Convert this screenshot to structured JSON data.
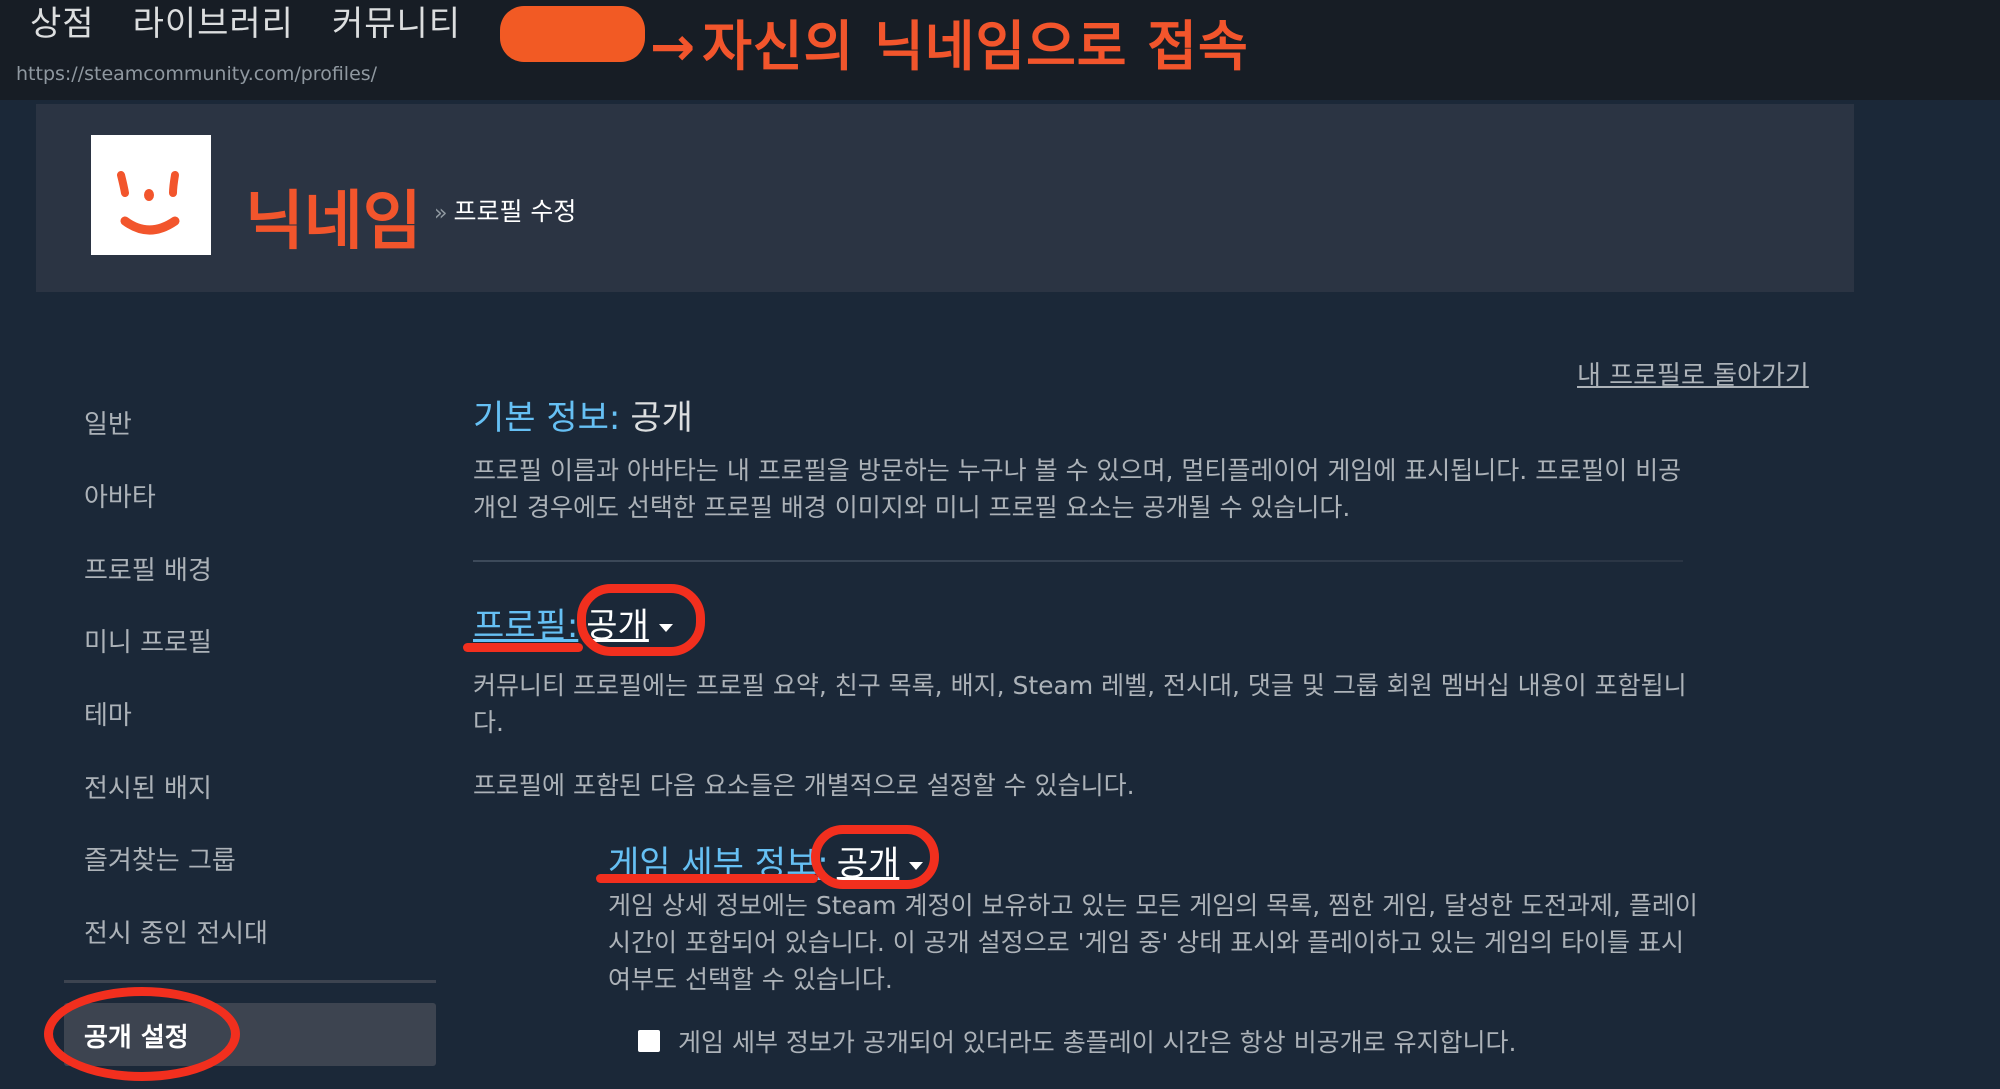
{
  "top_nav": {
    "items": [
      "상점",
      "라이브러리",
      "커뮤니티"
    ],
    "url": "https://steamcommunity.com/profiles/"
  },
  "annotation": {
    "top_arrow": "→",
    "top_note": "자신의 닉네임으로 접속",
    "nickname_note": "닉네임"
  },
  "profile_header": {
    "breadcrumb_sep": "»",
    "breadcrumb_page": "프로필 수정"
  },
  "sidebar": {
    "items": [
      "일반",
      "아바타",
      "프로필 배경",
      "미니 프로필",
      "테마",
      "전시된 배지",
      "즐겨찾는 그룹",
      "전시 중인 전시대"
    ],
    "active": "공개 설정"
  },
  "main": {
    "back_link": "내 프로필로 돌아가기",
    "basic": {
      "label": "기본 정보:",
      "value": "공개",
      "desc_line1": "프로필 이름과 아바타는 내 프로필을 방문하는 누구나 볼 수 있으며, 멀티플레이어 게임에 표시됩니다. 프로필이 비공",
      "desc_line2": "개인 경우에도 선택한 프로필 배경 이미지와 미니 프로필 요소는 공개될 수 있습니다."
    },
    "profile": {
      "label": "프로필:",
      "value": "공개",
      "desc_line1": "커뮤니티 프로필에는 프로필 요약, 친구 목록, 배지, Steam 레벨, 전시대, 댓글 및 그룹 회원 멤버십 내용이 포함됩니",
      "desc_line2": "다.",
      "sub_desc": "프로필에 포함된 다음 요소들은 개별적으로 설정할 수 있습니다."
    },
    "game_details": {
      "label": "게임 세부 정보:",
      "value": "공개",
      "desc_line1": "게임 상세 정보에는 Steam 계정이 보유하고 있는 모든 게임의 목록, 찜한 게임, 달성한 도전과제, 플레이",
      "desc_line2": "시간이 포함되어 있습니다. 이 공개 설정으로 '게임 중' 상태 표시와 플레이하고 있는 게임의 타이틀 표시",
      "desc_line3": "여부도 선택할 수 있습니다.",
      "checkbox_label": "게임 세부 정보가 공개되어 있더라도 총플레이 시간은 항상 비공개로 유지합니다."
    }
  },
  "colors": {
    "background": "#1b2838",
    "topbar": "#171d25",
    "accent_blue": "#66c0f4",
    "annotation_red": "#f22f1e",
    "annotation_orange": "#f2552c"
  }
}
